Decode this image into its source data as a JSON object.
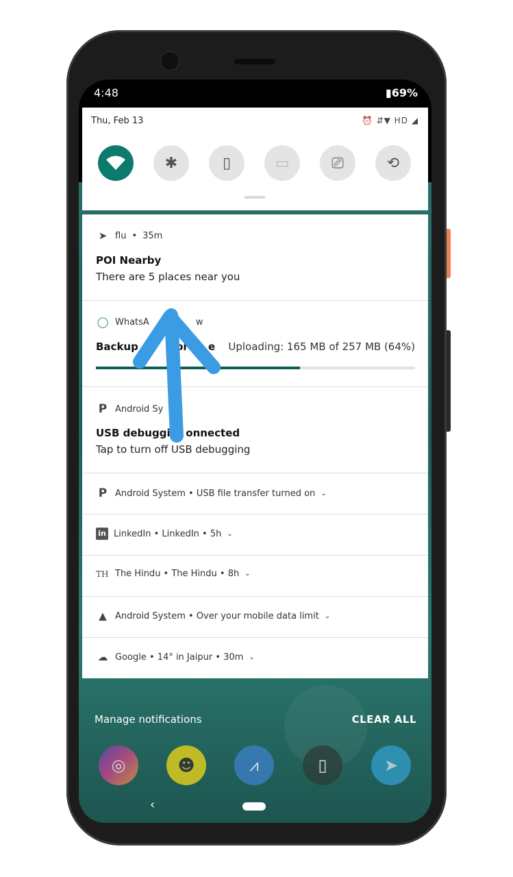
{
  "status_bar": {
    "time": "4:48",
    "battery": "69%"
  },
  "quick_settings": {
    "date": "Thu, Feb 13",
    "status_icons": "⏰ ⇵▼ HD ◢",
    "tiles": [
      "wifi",
      "bluetooth",
      "flashlight",
      "battery-saver",
      "cast",
      "auto-rotate"
    ]
  },
  "notifications": {
    "poi": {
      "app": "flu",
      "time": "35m",
      "title": "POI Nearby",
      "text": "There are 5 places near you"
    },
    "whatsapp": {
      "app": "WhatsApp",
      "app_partial": "WhatsA",
      "app_tail": "w",
      "title": "Backup in progress",
      "title_partial_a": "Backup",
      "title_partial_b": "or",
      "title_partial_c": "e",
      "status": "Uploading: 165 MB of 257 MB (64%)",
      "progress": 0.64
    },
    "usb_debug": {
      "app": "Android Sy",
      "title": "USB debugging connected",
      "title_a": "USB debuggin",
      "title_b": "onnected",
      "text": "Tap to turn off USB debugging"
    },
    "collapsed": [
      {
        "label": "Android System • USB file transfer turned on"
      },
      {
        "label": "LinkedIn • LinkedIn • 5h"
      },
      {
        "label": "The Hindu • The Hindu • 8h"
      },
      {
        "label": "Android System • Over your mobile data limit"
      },
      {
        "label": "Google • 14° in Jaipur • 30m"
      }
    ]
  },
  "footer": {
    "manage": "Manage notifications",
    "clear": "CLEAR ALL"
  },
  "colors": {
    "accent": "#0d7a6e",
    "arrow": "#3b9be3"
  }
}
